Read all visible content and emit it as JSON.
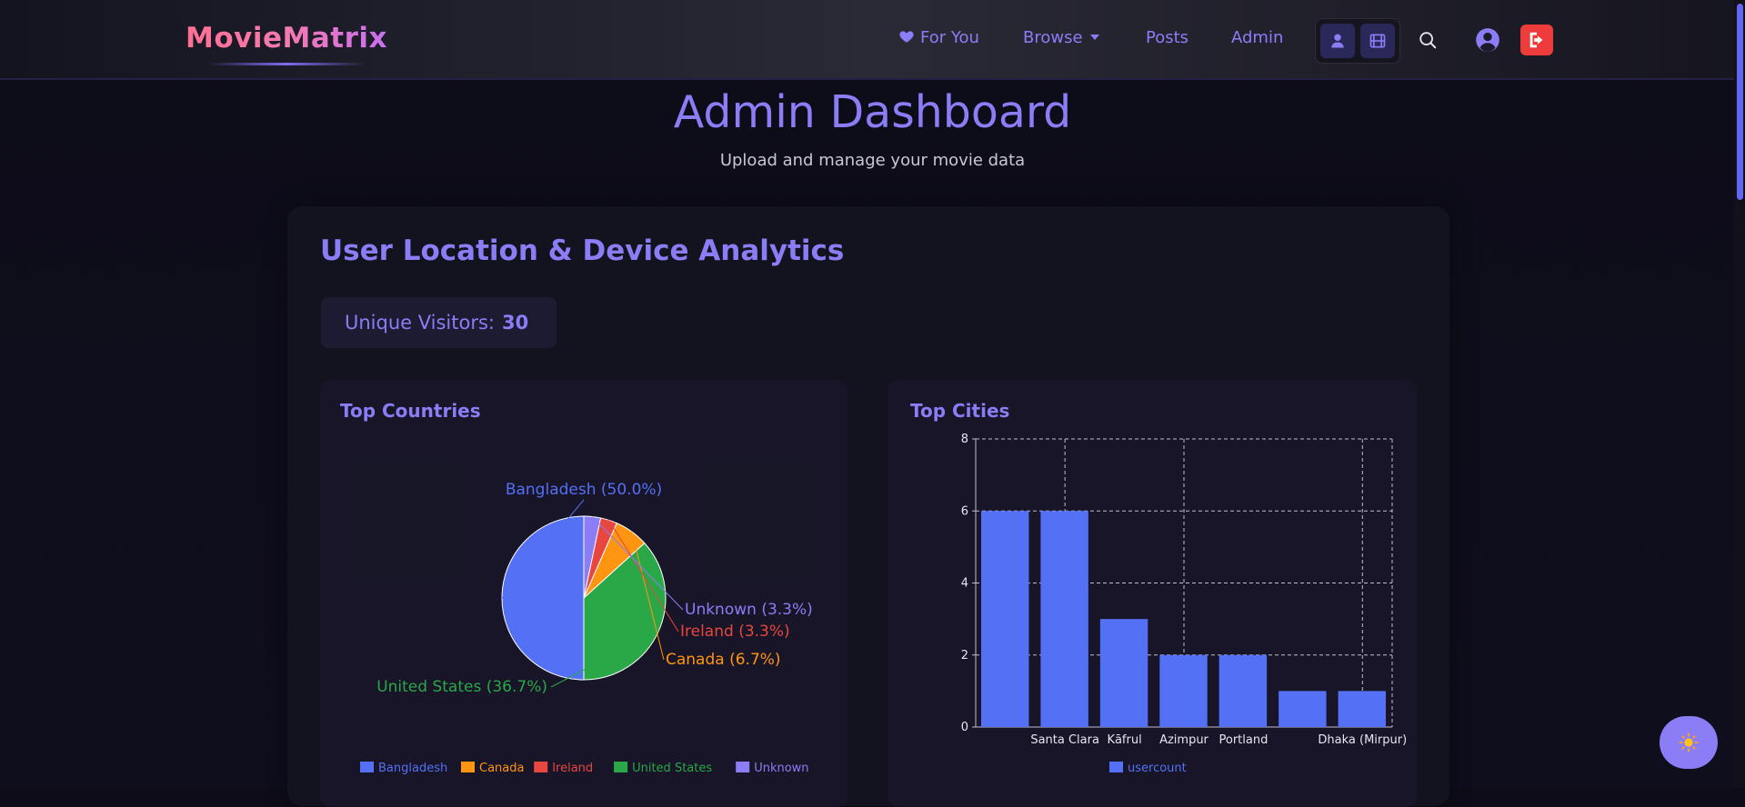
{
  "app": {
    "logo": "MovieMatrix"
  },
  "nav": {
    "for_you": "For You",
    "browse": "Browse",
    "posts": "Posts",
    "admin": "Admin"
  },
  "icons": {
    "for_you": "heart-icon",
    "user_mode": "user-icon",
    "film_mode": "film-icon",
    "search": "search-icon",
    "account": "account-circle-icon",
    "logout": "logout-icon",
    "theme": "sun-icon"
  },
  "colors": {
    "accent": "#8b7df6",
    "logout": "#ee3b3b",
    "bar": "#5470f5"
  },
  "page": {
    "title": "Admin Dashboard",
    "subtitle": "Upload and manage your movie data"
  },
  "analytics": {
    "section_title": "User Location & Device Analytics",
    "visitors_label": "Unique Visitors:",
    "visitors_count": "30"
  },
  "panels": {
    "countries_title": "Top Countries",
    "cities_title": "Top Cities"
  },
  "chart_data": [
    {
      "type": "pie",
      "title": "Top Countries",
      "legend_position": "bottom",
      "slices": [
        {
          "label": "Bangladesh",
          "value": 50.0,
          "display": "Bangladesh (50.0%)",
          "color": "#5470f5"
        },
        {
          "label": "Canada",
          "value": 6.7,
          "display": "Canada (6.7%)",
          "color": "#ff9510"
        },
        {
          "label": "Ireland",
          "value": 3.3,
          "display": "Ireland (3.3%)",
          "color": "#e8473f"
        },
        {
          "label": "United States",
          "value": 36.7,
          "display": "United States (36.7%)",
          "color": "#2aa848"
        },
        {
          "label": "Unknown",
          "value": 3.3,
          "display": "Unknown (3.3%)",
          "color": "#8b7df6"
        }
      ]
    },
    {
      "type": "bar",
      "title": "Top Cities",
      "categories": [
        "",
        "Santa Clara",
        "Kāfrul",
        "Azimpur",
        "Portland",
        "",
        "Dhaka (Mirpur)"
      ],
      "series": [
        {
          "name": "usercount",
          "values": [
            6,
            6,
            3,
            2,
            2,
            1,
            1
          ]
        }
      ],
      "ylim": [
        0,
        8
      ],
      "yticks": [
        0,
        2,
        4,
        6,
        8
      ],
      "grid": true,
      "legend_position": "bottom"
    }
  ]
}
